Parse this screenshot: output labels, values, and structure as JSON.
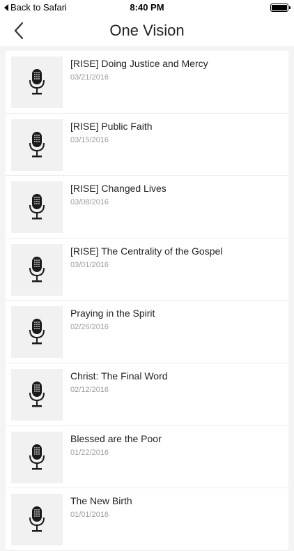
{
  "status_bar": {
    "back_label": "Back to Safari",
    "time": "8:40 PM"
  },
  "nav": {
    "title": "One Vision"
  },
  "sermons": [
    {
      "title": "[RISE] Doing Justice and Mercy",
      "date": "03/21/2016"
    },
    {
      "title": "[RISE] Public Faith",
      "date": "03/15/2016"
    },
    {
      "title": "[RISE] Changed Lives",
      "date": "03/08/2016"
    },
    {
      "title": "[RISE] The Centrality of the Gospel",
      "date": "03/01/2016"
    },
    {
      "title": "Praying in the Spirit",
      "date": "02/26/2016"
    },
    {
      "title": "Christ: The Final Word",
      "date": "02/12/2016"
    },
    {
      "title": "Blessed are the Poor",
      "date": "01/22/2016"
    },
    {
      "title": "The New Birth",
      "date": "01/01/2016"
    }
  ]
}
